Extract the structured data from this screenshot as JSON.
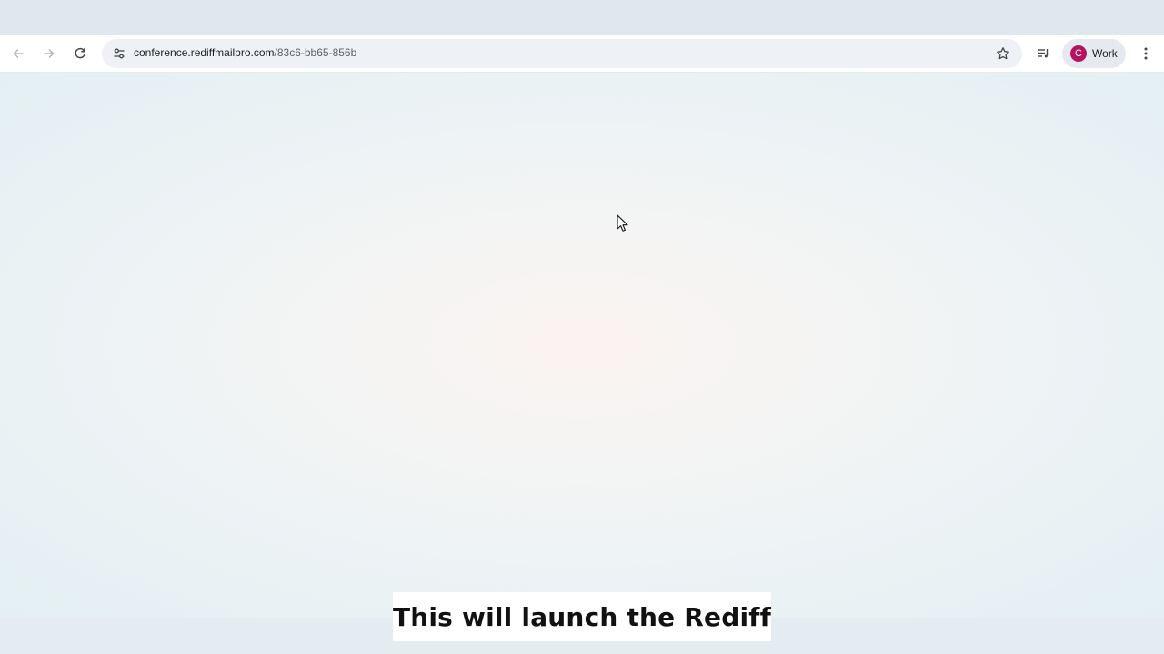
{
  "browser": {
    "url_host": "conference.rediffmailpro.com",
    "url_path": "/83c6-bb65-856b",
    "profile": {
      "initial": "C",
      "name": "Work",
      "color": "#b5135d"
    },
    "icons": {
      "back": "arrow-left-icon",
      "forward": "arrow-right-icon",
      "reload": "reload-icon",
      "site_info": "tune-icon",
      "bookmark": "star-icon",
      "media": "media-queue-icon",
      "menu": "more-vertical-icon"
    }
  },
  "caption": {
    "text": "This will launch the Rediff"
  }
}
